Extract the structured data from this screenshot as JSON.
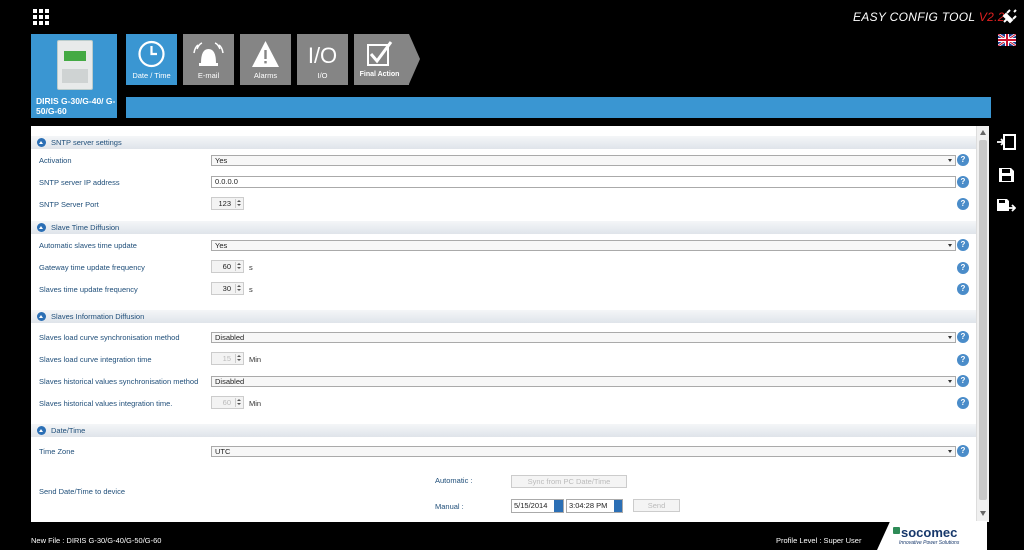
{
  "app": {
    "title": "EASY CONFIG TOOL ",
    "version": "V2.2",
    "device_label": "DIRIS G-30/G-40/ G-50/G-60"
  },
  "steps": [
    {
      "label": "Date / Time",
      "icon": "clock-icon",
      "active": true
    },
    {
      "label": "E-mail",
      "icon": "alarm-bell-icon",
      "active": false
    },
    {
      "label": "Alarms",
      "icon": "warning-icon",
      "active": false
    },
    {
      "label": "I/O",
      "icon": "io-icon",
      "active": false
    },
    {
      "label": "Final Action",
      "icon": "checkmark-icon",
      "active": false
    }
  ],
  "sections": {
    "sntp": "SNTP server settings",
    "slave_time": "Slave Time Diffusion",
    "slave_info": "Slaves Information Diffusion",
    "datetime": "Date/Time"
  },
  "fields": {
    "activation": {
      "label": "Activation",
      "value": "Yes"
    },
    "sntp_ip": {
      "label": "SNTP server IP address",
      "value": "0.0.0.0"
    },
    "sntp_port": {
      "label": "SNTP Server Port",
      "value": "123"
    },
    "auto_slave": {
      "label": "Automatic slaves time update",
      "value": "Yes"
    },
    "gw_freq": {
      "label": "Gateway time update frequency",
      "value": "60",
      "unit": "s"
    },
    "slave_freq": {
      "label": "Slaves time update frequency",
      "value": "30",
      "unit": "s"
    },
    "load_sync": {
      "label": "Slaves load curve synchronisation method",
      "value": "Disabled"
    },
    "load_integ": {
      "label": "Slaves load curve integration time",
      "value": "15",
      "unit": "Min"
    },
    "hist_sync": {
      "label": "Slaves historical values synchronisation method",
      "value": "Disabled"
    },
    "hist_integ": {
      "label": "Slaves historical values integration time.",
      "value": "60",
      "unit": "Min"
    },
    "timezone": {
      "label": "Time Zone",
      "value": "UTC"
    },
    "send": {
      "label": "Send Date/Time to device",
      "automatic": "Automatic :",
      "manual": "Manual :",
      "sync_button": "Sync from PC Date/Time",
      "date": "5/15/2014",
      "time": "3:04:28 PM",
      "send_button": "Send"
    }
  },
  "help_glyph": "?",
  "footer": {
    "file": "New File : DIRIS G-30/G-40/G-50/G-60",
    "profile": "Profile Level : Super User",
    "logo": "socomec",
    "tagline": "Innovative Power Solutions"
  },
  "colors": {
    "accent": "#3a96d2",
    "tab_inactive": "#858585",
    "label": "#1f4e79"
  }
}
